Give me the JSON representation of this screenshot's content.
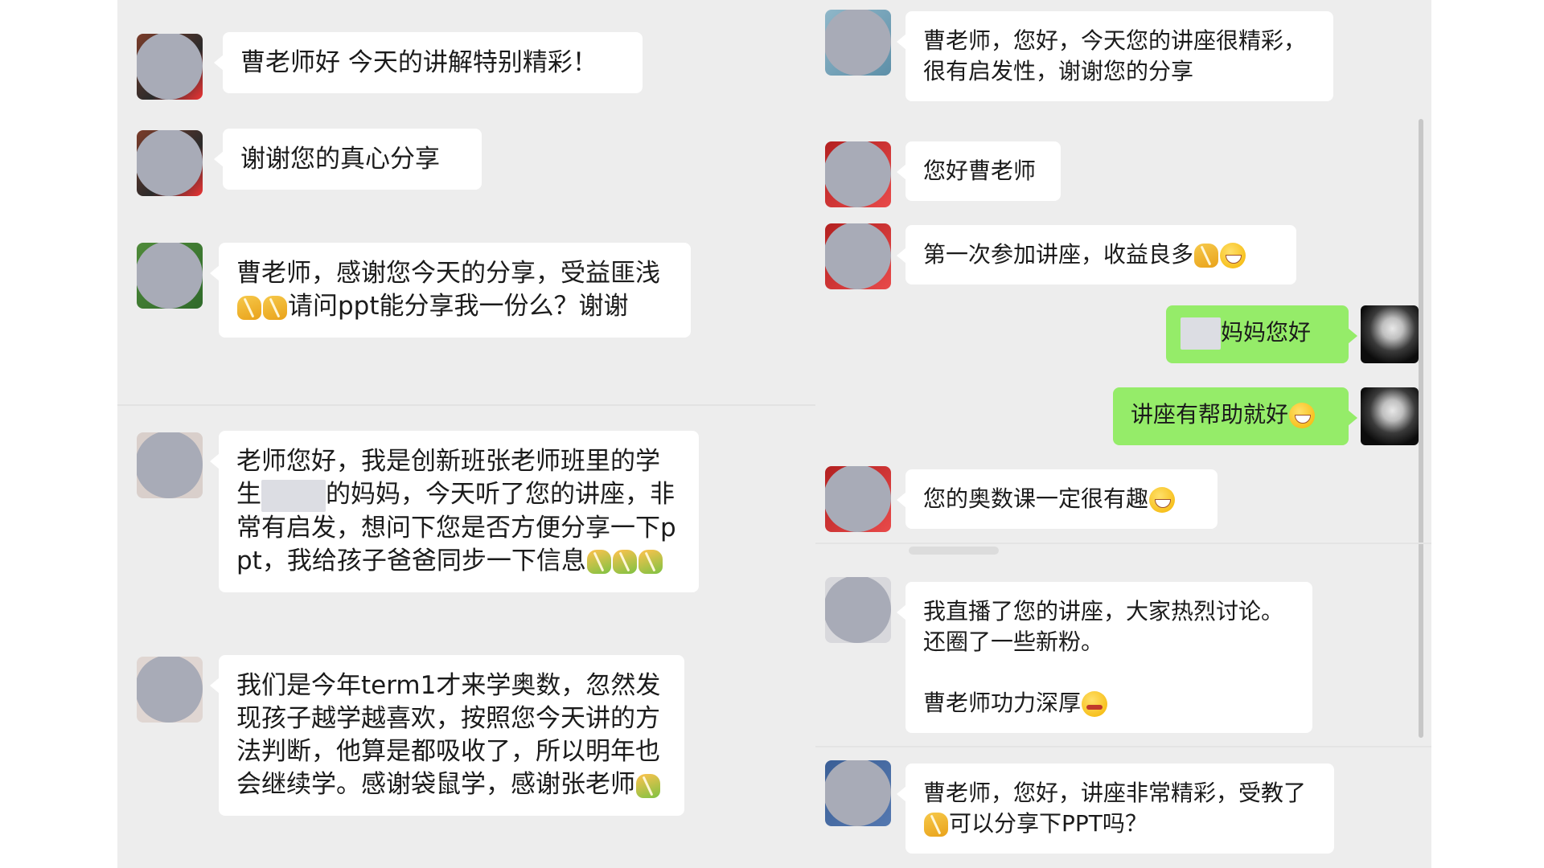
{
  "left_chat": {
    "messages": [
      {
        "segments": [
          {
            "type": "text",
            "value": "曹老师好 今天的讲解特别精彩！"
          }
        ]
      },
      {
        "segments": [
          {
            "type": "text",
            "value": "谢谢您的真心分享"
          }
        ]
      },
      {
        "segments": [
          {
            "type": "text",
            "value": "曹老师，感谢您今天的分享，受益匪浅"
          },
          {
            "type": "emoji",
            "name": "folded-hands-icon"
          },
          {
            "type": "emoji",
            "name": "folded-hands-icon"
          },
          {
            "type": "text",
            "value": "请问ppt能分享我一份么？谢谢"
          }
        ]
      },
      {
        "segments": [
          {
            "type": "text",
            "value": "老师您好，我是创新班张老师班里的学生"
          },
          {
            "type": "redacted"
          },
          {
            "type": "text",
            "value": "的妈妈，今天听了您的讲座，非常有启发，想问下您是否方便分享一下ppt，我给孩子爸爸同步一下信息"
          },
          {
            "type": "emoji",
            "name": "folded-hands-icon"
          },
          {
            "type": "emoji",
            "name": "folded-hands-icon"
          },
          {
            "type": "emoji",
            "name": "folded-hands-icon"
          }
        ]
      },
      {
        "segments": [
          {
            "type": "text",
            "value": "我们是今年term1才来学奥数，忽然发现孩子越学越喜欢，按照您今天讲的方法判断，他算是都吸收了，所以明年也会继续学。感谢袋鼠学，感谢张老师"
          },
          {
            "type": "emoji",
            "name": "folded-hands-icon"
          }
        ]
      }
    ]
  },
  "right_chat": {
    "messages": [
      {
        "segments": [
          {
            "type": "text",
            "value": "曹老师，您好，今天您的讲座很精彩，很有启发性，谢谢您的分享"
          }
        ]
      },
      {
        "segments": [
          {
            "type": "text",
            "value": "您好曹老师"
          }
        ]
      },
      {
        "segments": [
          {
            "type": "text",
            "value": "第一次参加讲座，收益良多"
          },
          {
            "type": "emoji",
            "name": "folded-hands-icon"
          },
          {
            "type": "emoji",
            "name": "grinning-face-icon"
          }
        ]
      },
      {
        "sender": "me",
        "segments": [
          {
            "type": "redacted"
          },
          {
            "type": "text",
            "value": "妈妈您好"
          }
        ]
      },
      {
        "sender": "me",
        "segments": [
          {
            "type": "text",
            "value": "讲座有帮助就好"
          },
          {
            "type": "emoji",
            "name": "grinning-face-icon"
          }
        ]
      },
      {
        "segments": [
          {
            "type": "text",
            "value": "您的奥数课一定很有趣"
          },
          {
            "type": "emoji",
            "name": "grinning-face-icon"
          }
        ]
      },
      {
        "segments": [
          {
            "type": "text",
            "value": "我直播了您的讲座，大家热烈讨论。还圈了一些新粉。\n\n曹老师功力深厚"
          },
          {
            "type": "emoji",
            "name": "smirking-face-icon"
          }
        ]
      },
      {
        "segments": [
          {
            "type": "text",
            "value": "曹老师，您好，讲座非常精彩，受教了"
          },
          {
            "type": "emoji",
            "name": "folded-hands-icon"
          },
          {
            "type": "text",
            "value": "可以分享下PPT吗？"
          }
        ]
      }
    ]
  },
  "colors": {
    "panel_background": "#ededed",
    "incoming_bubble": "#ffffff",
    "outgoing_bubble": "#95ec69",
    "blurred_avatar": "#a8abb7"
  }
}
